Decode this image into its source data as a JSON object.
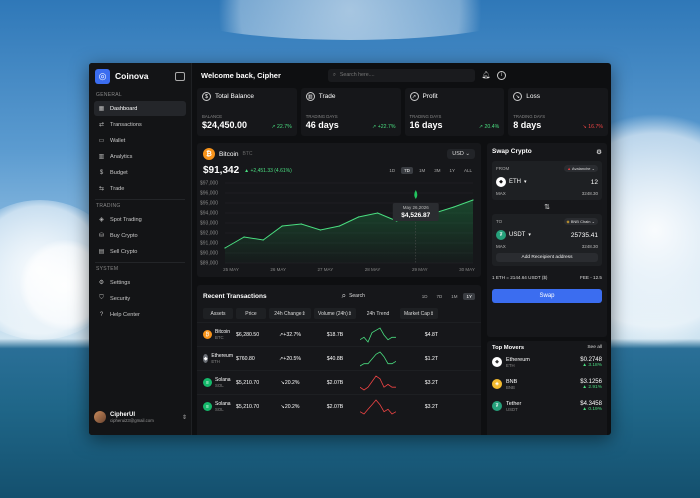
{
  "app": {
    "name": "Coinova"
  },
  "sidebar": {
    "general_title": "GENERAL",
    "general": [
      {
        "label": "Dashboard",
        "icon": "grid-icon"
      },
      {
        "label": "Transactions",
        "icon": "arrows-icon"
      },
      {
        "label": "Wallet",
        "icon": "wallet-icon"
      },
      {
        "label": "Analytics",
        "icon": "chart-icon"
      },
      {
        "label": "Budget",
        "icon": "dollar-icon"
      },
      {
        "label": "Trade",
        "icon": "trade-icon"
      }
    ],
    "trading_title": "TRADING",
    "trading": [
      {
        "label": "Spot Trading",
        "icon": "spot-icon"
      },
      {
        "label": "Buy Crypto",
        "icon": "cart-icon"
      },
      {
        "label": "Sell Crypto",
        "icon": "sell-icon"
      }
    ],
    "system_title": "SYSTEM",
    "system": [
      {
        "label": "Settings",
        "icon": "gear-icon"
      },
      {
        "label": "Security",
        "icon": "shield-icon"
      },
      {
        "label": "Help Center",
        "icon": "help-icon"
      }
    ],
    "user": {
      "name": "CipherUI",
      "email": "cipherui23@gmail.com"
    }
  },
  "header": {
    "welcome": "Welcome back, Cipher",
    "search_placeholder": "Search here...."
  },
  "stats": [
    {
      "title": "Total Balance",
      "sub": "BALANCE",
      "value": "$24,450.00",
      "change": "22.7%",
      "dir": "up"
    },
    {
      "title": "Trade",
      "sub": "TRADING DAYS",
      "value": "46 days",
      "change": "+22.7%",
      "dir": "up"
    },
    {
      "title": "Profit",
      "sub": "TRADING DAYS",
      "value": "16 days",
      "change": "20.4%",
      "dir": "up"
    },
    {
      "title": "Loss",
      "sub": "TRADING DAYS",
      "value": "8 days",
      "change": "16.7%",
      "dir": "down"
    }
  ],
  "chart_card": {
    "coin": "Bitcoin",
    "symbol": "BTC",
    "currency": "USD",
    "price": "$91,342",
    "change": "+2,451.33 (4.61%)",
    "ranges": [
      "1D",
      "7D",
      "1M",
      "3M",
      "1Y",
      "ALL"
    ],
    "active_range": "7D",
    "tooltip_date": "May 26,2026",
    "tooltip_value": "$4,526.87"
  },
  "chart_data": {
    "type": "area",
    "yticks": [
      "$97,000",
      "$96,000",
      "$95,000",
      "$94,000",
      "$93,000",
      "$92,000",
      "$91,000",
      "$90,000",
      "$89,000"
    ],
    "xticks": [
      "25 MAY",
      "26 MAY",
      "27 MAY",
      "28 MAY",
      "29 MAY",
      "30 MAY"
    ],
    "ylim": [
      89000,
      97000
    ],
    "x": [
      0,
      0.4,
      0.8,
      1.2,
      1.6,
      2.0,
      2.4,
      2.8,
      3.2,
      3.6,
      4.0,
      4.4,
      4.8,
      5.2
    ],
    "values": [
      90500,
      91600,
      91300,
      92700,
      92900,
      92300,
      92700,
      93600,
      94000,
      93200,
      94900,
      94000,
      94600,
      95300
    ],
    "grid": true,
    "accent": "#4ade80"
  },
  "transactions": {
    "title": "Recent Transactions",
    "search": "Search",
    "ranges": [
      "1D",
      "7D",
      "1M",
      "1Y"
    ],
    "active_range": "1Y",
    "columns": [
      "Assets",
      "Price",
      "24h Change",
      "Volume (24h)",
      "24h Trend",
      "Market Cap"
    ],
    "rows": [
      {
        "name": "Bitcoin",
        "sym": "BTC",
        "price": "$6,280.50",
        "change": "+32.7%",
        "dir": "up",
        "volume": "$18.7B",
        "cap": "$4.8T",
        "color": "#f7931a",
        "glyph": "₿",
        "trend": [
          6,
          5,
          7,
          3,
          2,
          1,
          4,
          6,
          5,
          5
        ]
      },
      {
        "name": "Ethereum",
        "sym": "ETH",
        "price": "$760.80",
        "change": "+20.5%",
        "dir": "up",
        "volume": "$40.8B",
        "cap": "$1.2T",
        "color": "#6b6f76",
        "glyph": "◆",
        "trend": [
          7,
          6,
          6,
          4,
          2,
          1,
          3,
          6,
          6,
          5
        ]
      },
      {
        "name": "Solana",
        "sym": "SOL",
        "price": "$5,210.70",
        "change": "20.2%",
        "dir": "down",
        "volume": "$2.07B",
        "cap": "$3.2T",
        "color": "#14b86a",
        "glyph": "≡",
        "trend": [
          6,
          7,
          6,
          4,
          2,
          3,
          6,
          5,
          6,
          6
        ]
      },
      {
        "name": "Solana",
        "sym": "SOL",
        "price": "$5,210.70",
        "change": "20.2%",
        "dir": "down",
        "volume": "$2.07B",
        "cap": "$3.2T",
        "color": "#14b86a",
        "glyph": "≡",
        "trend": [
          6,
          7,
          5,
          3,
          1,
          3,
          6,
          5,
          7,
          6
        ]
      }
    ]
  },
  "swap": {
    "title": "Swap Crypto",
    "from_label": "FROM",
    "from_chain": "Avalanche",
    "from_token": "ETH",
    "from_amount": "12",
    "from_max_label": "MAX",
    "from_max": "3248.30",
    "to_label": "TO",
    "to_chain": "BNB Chain",
    "to_token": "USDT",
    "to_amount": "25735.41",
    "to_max_label": "MAX",
    "to_max": "3248.30",
    "add_address": "Add Receipient address",
    "rate": "1 ETH = 2144.64 USDT ($)",
    "fee": "FEE - 12.5",
    "button": "Swap"
  },
  "movers": {
    "title": "Top Movers",
    "see_all": "See all",
    "items": [
      {
        "name": "Ethereum",
        "sym": "ETH",
        "price": "$0.2748",
        "change": "3.18%",
        "color": "#ffffff",
        "glyph": "◆"
      },
      {
        "name": "BNB",
        "sym": "BNB",
        "price": "$3.1256",
        "change": "2.91%",
        "color": "#f3ba2f",
        "glyph": "◈"
      },
      {
        "name": "Tether",
        "sym": "USDT",
        "price": "$4.3458",
        "change": "0.19%",
        "color": "#26a17b",
        "glyph": "₮"
      }
    ]
  }
}
